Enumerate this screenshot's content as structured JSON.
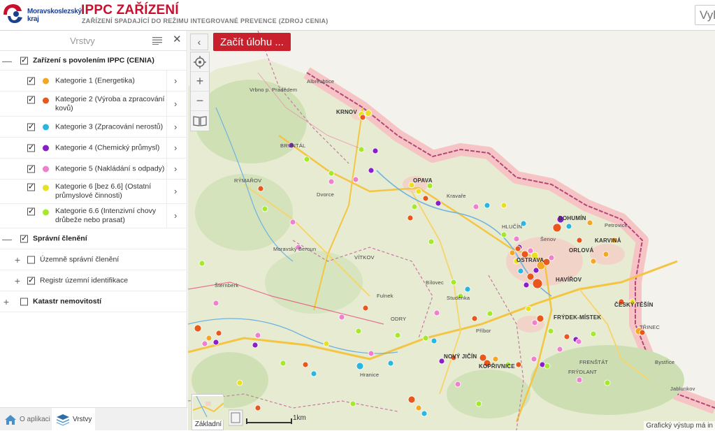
{
  "header": {
    "logo_text_line1": "Moravskoslezský",
    "logo_text_line2": "kraj",
    "title": "IPPC ZAŘÍZENÍ",
    "subtitle": "ZAŘÍZENÍ SPADAJÍCÍ DO REŽIMU INTEGROVANÉ PREVENCE (ZDROJ CENIA)",
    "search_placeholder": "Vyhledat"
  },
  "panel": {
    "title": "Vrstvy",
    "groups": [
      {
        "label": "Zařízení s povolením IPPC (CENIA)",
        "checked": true,
        "expander": "—"
      },
      {
        "label": "Správní členění",
        "checked": true,
        "expander": "—"
      },
      {
        "label": "Katastr nemovitostí",
        "checked": false,
        "expander": "+"
      }
    ],
    "categories": [
      {
        "line1": "Kategorie 1 (Energetika)",
        "line2": "",
        "color": "#f5a623"
      },
      {
        "line1": "Kategorie 2 (Výroba a zpracování",
        "line2": "kovů)",
        "color": "#e8581c"
      },
      {
        "line1": "Kategorie 3 (Zpracování nerostů)",
        "line2": "",
        "color": "#29b6e0"
      },
      {
        "line1": "Kategorie 4 (Chemický průmysl)",
        "line2": "",
        "color": "#8a1ec8"
      },
      {
        "line1": "Kategorie 5 (Nakládání s odpady)",
        "line2": "",
        "color": "#f07fd0"
      },
      {
        "line1": "Kategorie 6 [bez 6.6] (Ostatní",
        "line2": "průmyslové činnosti)",
        "color": "#e8e020"
      },
      {
        "line1": "Kategorie 6.6 (Intenzivní chovy",
        "line2": "drůbeže nebo prasat)",
        "color": "#a6e82a"
      }
    ],
    "sublayers": [
      {
        "label": "Územně správní členění",
        "checked": false,
        "expander": "+"
      },
      {
        "label": "Registr územní identifikace",
        "checked": true,
        "expander": "+"
      }
    ]
  },
  "bottom_tabs": [
    {
      "label": "O aplikaci"
    },
    {
      "label": "Vrstvy"
    }
  ],
  "map": {
    "task_button": "Začít úlohu ...",
    "basemap_label": "Základní",
    "attribution": "Grafický výstup má in",
    "scale_text": "1km",
    "towns": [
      "KRNOV",
      "OPAVA",
      "BOHUMÍN",
      "KARVINÁ",
      "ORLOVÁ",
      "OSTRAVA",
      "HAVÍŘOV",
      "FRÝDEK-MÍSTEK",
      "ČESKÝ TĚŠÍN",
      "NOVÝ JIČÍN",
      "KOPŘIVNICE",
      "BRUNTÁL",
      "RÝMAŘOV",
      "VÍTKOV",
      "ODRY",
      "HLUČÍN",
      "FRENŠTÁT",
      "FRÝDLANT",
      "TŘINEC",
      "Bílovec",
      "Studénka",
      "Příbor",
      "Hranice",
      "Fulnek",
      "Kravaře",
      "Vrbno p. Pradědem",
      "Albrechtice",
      "Jablunkov",
      "Bystřice",
      "Petrovice",
      "Šenov",
      "Dvorce",
      "Moravský Beroun",
      "Šternberk"
    ]
  }
}
